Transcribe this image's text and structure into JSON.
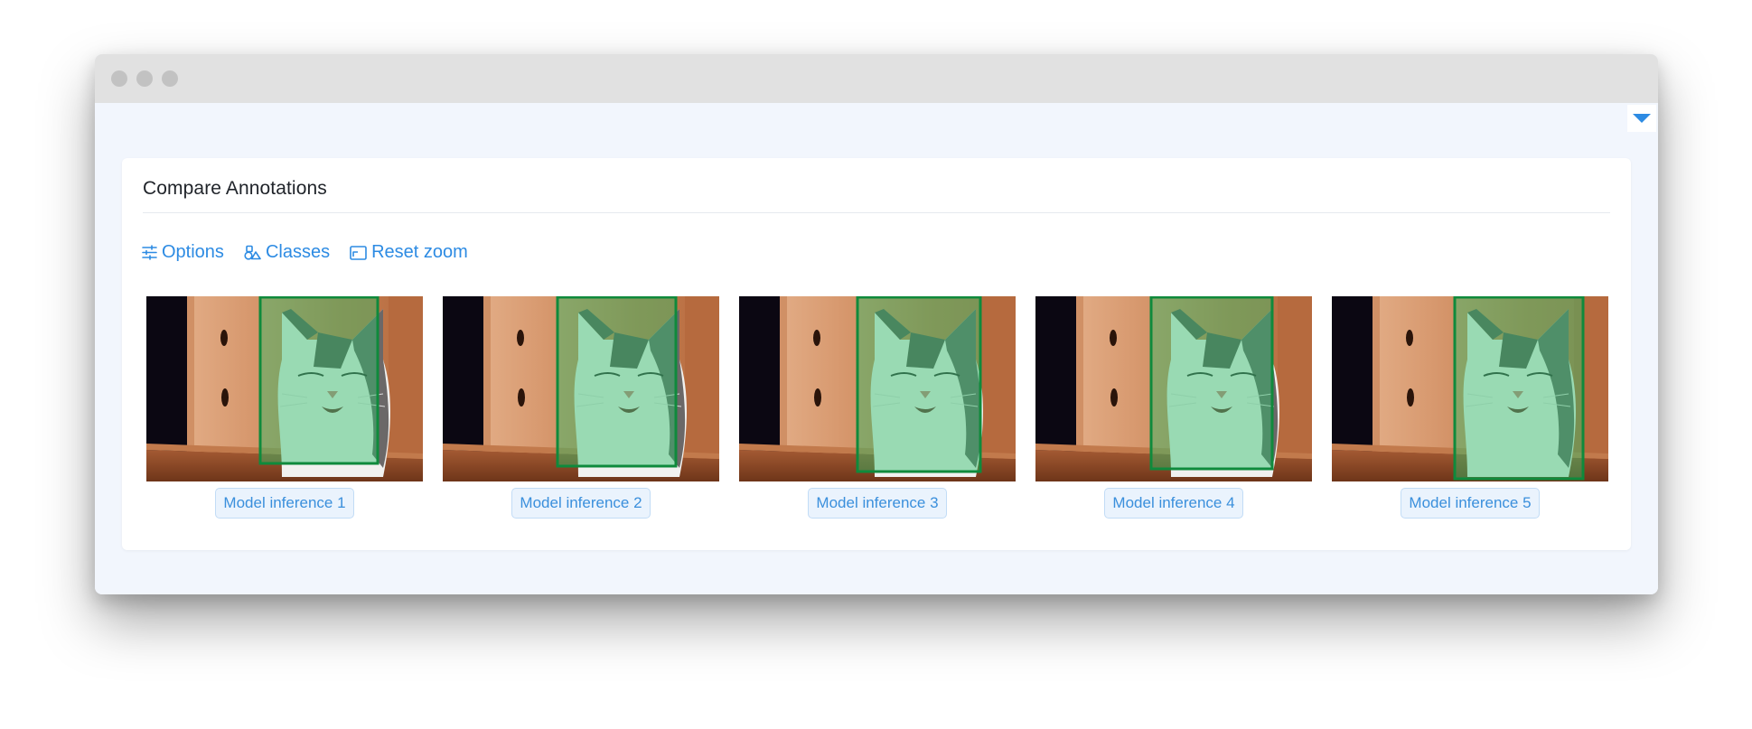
{
  "card": {
    "title": "Compare Annotations"
  },
  "toolbar": {
    "options_label": "Options",
    "classes_label": "Classes",
    "reset_zoom_label": "Reset zoom"
  },
  "colors": {
    "accent": "#2d8be3",
    "box_stroke": "#0f8a3c",
    "box_fill": "#2fbf6a"
  },
  "icons": {
    "options": "sliders-icon",
    "classes": "shapes-icon",
    "reset_zoom": "image-frame-icon",
    "dropdown": "caret-down-icon"
  },
  "comparisons": [
    {
      "label": "Model inference 1"
    },
    {
      "label": "Model inference 2"
    },
    {
      "label": "Model inference 3"
    },
    {
      "label": "Model inference 4"
    },
    {
      "label": "Model inference 5"
    }
  ]
}
